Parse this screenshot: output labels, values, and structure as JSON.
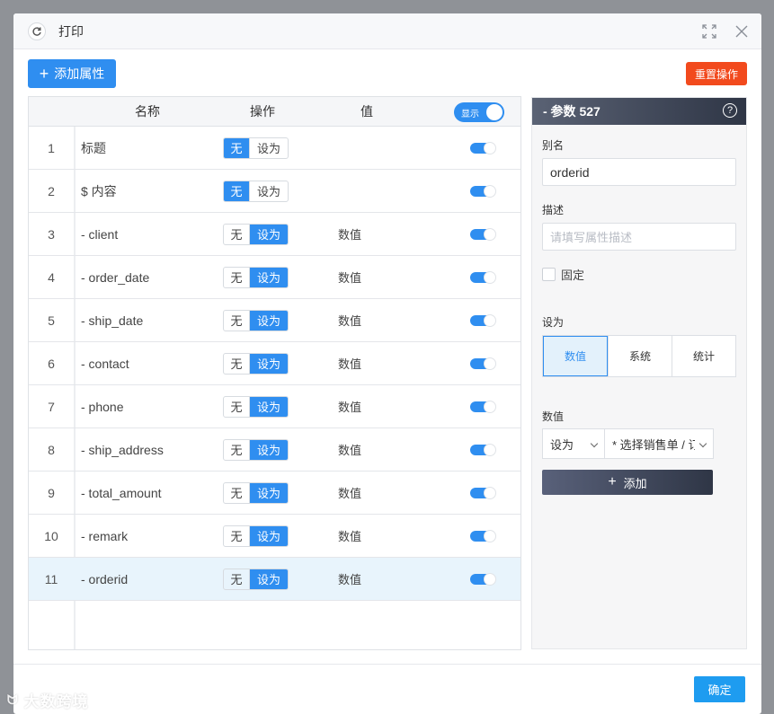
{
  "dialog": {
    "title": "打印",
    "icons": [
      "refresh-icon",
      "fullscreen-icon",
      "close-icon"
    ]
  },
  "toolbar": {
    "add_property_label": "添加属性",
    "reset_label": "重置操作"
  },
  "table": {
    "columns": [
      "名称",
      "操作",
      "值"
    ],
    "show_toggle_label": "显示",
    "show_toggle_on": true,
    "rows": [
      {
        "index": "1",
        "name": "标题",
        "mode": "无",
        "value": "",
        "visible": true
      },
      {
        "index": "2",
        "name": "$ 内容",
        "mode": "无",
        "value": "",
        "visible": true
      },
      {
        "index": "3",
        "name": "- client",
        "mode": "设为",
        "value": "数值",
        "visible": true
      },
      {
        "index": "4",
        "name": "- order_date",
        "mode": "设为",
        "value": "数值",
        "visible": true
      },
      {
        "index": "5",
        "name": "- ship_date",
        "mode": "设为",
        "value": "数值",
        "visible": true
      },
      {
        "index": "6",
        "name": "- contact",
        "mode": "设为",
        "value": "数值",
        "visible": true
      },
      {
        "index": "7",
        "name": "- phone",
        "mode": "设为",
        "value": "数值",
        "visible": true
      },
      {
        "index": "8",
        "name": "- ship_address",
        "mode": "设为",
        "value": "数值",
        "visible": true
      },
      {
        "index": "9",
        "name": "- total_amount",
        "mode": "设为",
        "value": "数值",
        "visible": true
      },
      {
        "index": "10",
        "name": "- remark",
        "mode": "设为",
        "value": "数值",
        "visible": true
      },
      {
        "index": "11",
        "name": "- orderid",
        "mode": "设为",
        "value": "数值",
        "visible": true,
        "selected": true
      }
    ],
    "mode_options": [
      "无",
      "设为"
    ]
  },
  "panel": {
    "title": "- 参数 527",
    "alias_label": "别名",
    "alias_value": "orderid",
    "desc_label": "描述",
    "desc_placeholder": "请填写属性描述",
    "fixed_label": "固定",
    "set_as_label": "设为",
    "set_as_options": [
      "数值",
      "系统",
      "统计"
    ],
    "set_as_selected": "数值",
    "value_label": "数值",
    "value_mode_select": "设为",
    "value_source_select": "* 选择销售单 / 订单编号",
    "add_label": "添加"
  },
  "footer": {
    "ok_label": "确定"
  },
  "watermark": "大数跨境",
  "colors": {
    "primary": "#2f8ef0",
    "danger": "#f24a1d",
    "panel_header": "#3a4254",
    "selected_row": "#e8f4fc"
  }
}
